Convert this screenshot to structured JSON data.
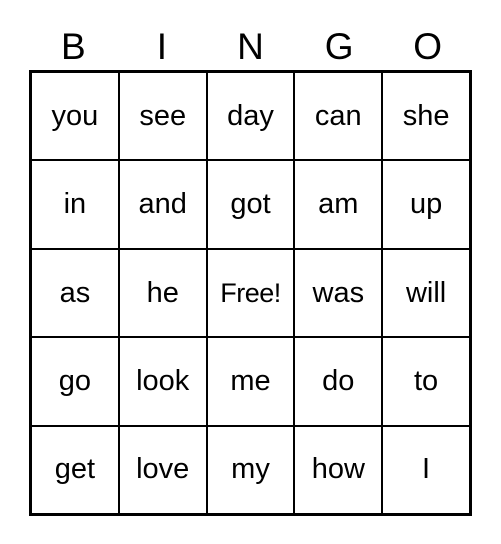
{
  "card": {
    "title": "BINGO",
    "header_letters": [
      "B",
      "I",
      "N",
      "G",
      "O"
    ],
    "free_space_label": "Free!",
    "free_space_position": {
      "row": 2,
      "col": 2
    },
    "grid_size": "5x5",
    "colors": {
      "background": "#ffffff",
      "text": "#000000",
      "grid_line": "#000000"
    },
    "rows": [
      {
        "cells": [
          "you",
          "see",
          "day",
          "can",
          "she"
        ]
      },
      {
        "cells": [
          "in",
          "and",
          "got",
          "am",
          "up"
        ]
      },
      {
        "cells": [
          "as",
          "he",
          "Free!",
          "was",
          "will"
        ]
      },
      {
        "cells": [
          "go",
          "look",
          "me",
          "do",
          "to"
        ]
      },
      {
        "cells": [
          "get",
          "love",
          "my",
          "how",
          "I"
        ]
      }
    ]
  }
}
